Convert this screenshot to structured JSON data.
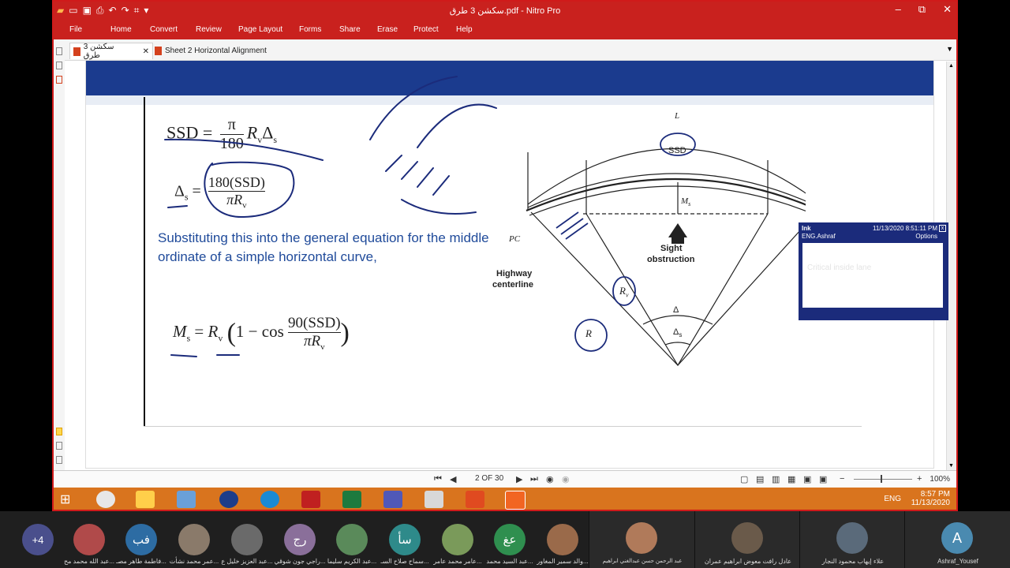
{
  "window": {
    "title": "سكشن 3 طرق.pdf - Nitro Pro",
    "controls": {
      "minimize": "–",
      "maximize": "⧉",
      "close": "✕"
    }
  },
  "ribbon": {
    "file": "File",
    "tabs": [
      "Home",
      "Convert",
      "Review",
      "Page Layout",
      "Forms",
      "Share",
      "Erase",
      "Protect",
      "Help"
    ]
  },
  "doc_tabs": [
    {
      "label": "سكشن 3 طرق",
      "active": true,
      "close": "✕"
    },
    {
      "label": "Sheet 2 Horizontal Alignment",
      "active": false
    }
  ],
  "slide": {
    "eq1": {
      "lhs": "SSD =",
      "frac_num": "π",
      "frac_den": "180",
      "rhs": "R",
      "rhs_sub": "v",
      "delta": "Δ",
      "delta_sub": "s"
    },
    "eq2": {
      "lhs": "Δ",
      "lhs_sub": "s",
      "eq": "=",
      "num": "180(SSD)",
      "den": "πR",
      "den_sub": "v"
    },
    "paragraph": "Substituting this into the general equation for the middle ordinate of a simple horizontal curve,",
    "eq3": {
      "lhs": "M",
      "lhs_sub": "s",
      "eq": "=",
      "r": "R",
      "r_sub": "v",
      "inner": "1 − cos",
      "num": "90(SSD)",
      "den": "πR",
      "den_sub": "v"
    },
    "figure": {
      "L": "L",
      "SSD": "SSD",
      "Ms": "M",
      "Ms_sub": "s",
      "pc": "PC",
      "highway": "Highway",
      "centerline": "centerline",
      "sight1": "Sight",
      "sight2": "obstruction",
      "Rv": "R",
      "Rv_sub": "v",
      "R": "R",
      "delta": "Δ",
      "delta_s": "Δ",
      "delta_s_sub": "s"
    }
  },
  "ink_note": {
    "title": "Ink",
    "author": "ENG.Ashraf",
    "timestamp": "11/13/2020 8:51:11 PM",
    "options": "Options",
    "text": "Critical inside lane"
  },
  "statusbar": {
    "page": "2 OF 30",
    "zoom": "100%"
  },
  "taskbar": {
    "lang": "ENG",
    "time": "8:57 PM",
    "date": "11/13/2020"
  },
  "participants": {
    "more": "+4",
    "small": [
      {
        "initials": "",
        "name": "عبد الله محمد مح..."
      },
      {
        "initials": "فب",
        "name": "فاطمة طاهر مصـ..."
      },
      {
        "initials": "",
        "name": "عمر محمد نشأت..."
      },
      {
        "initials": "",
        "name": "عبد العزيز خليل ع..."
      },
      {
        "initials": "رج",
        "name": "راجي جون شوقي..."
      },
      {
        "initials": "",
        "name": "عبد الكريم سليما..."
      },
      {
        "initials": "سأ",
        "name": "سماح صلاح السـ..."
      },
      {
        "initials": "",
        "name": "عامر محمد عامر..."
      },
      {
        "initials": "عغ",
        "name": "عبد السيد محمد..."
      },
      {
        "initials": "",
        "name": "والد سمير المغاور..."
      }
    ],
    "large": [
      {
        "name": "عبد الرحمن حسن عبدالغني ابراهيم"
      },
      {
        "name": "عادل رافت معوض ابراهيم عمران"
      },
      {
        "name": "علاء إيهاب محمود النجار"
      },
      {
        "initials": "A",
        "name": "Ashraf_Yousef"
      }
    ]
  },
  "colors": {
    "nitro_red": "#c9211e",
    "slide_blue_text": "#1f4a9a",
    "taskbar_orange": "#d9741e",
    "ink_popup_navy": "#1b2b7b"
  }
}
